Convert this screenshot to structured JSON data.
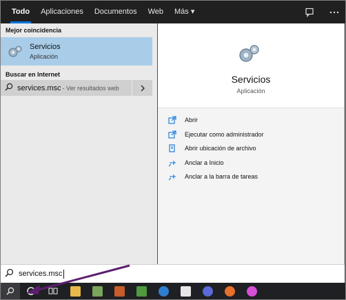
{
  "tabs": [
    "Todo",
    "Aplicaciones",
    "Documentos",
    "Web",
    "Más ▾"
  ],
  "topbar_icons": [
    "feedback-icon",
    "more-icon"
  ],
  "left": {
    "best_match_title": "Mejor coincidencia",
    "best_match": {
      "name": "Servicios",
      "type": "Aplicación",
      "icon": "services-gear-icon"
    },
    "web_title": "Buscar en Internet",
    "web_result": {
      "query": "services.msc",
      "hint": " - Ver resultados web"
    }
  },
  "detail": {
    "title": "Servicios",
    "subtitle": "Aplicación",
    "actions": [
      {
        "label": "Abrir",
        "icon": "open-icon"
      },
      {
        "label": "Ejecutar como administrador",
        "icon": "run-as-admin-icon"
      },
      {
        "label": "Abrir ubicación de archivo",
        "icon": "file-location-icon"
      },
      {
        "label": "Anclar a Inicio",
        "icon": "pin-start-icon"
      },
      {
        "label": "Anclar a la barra de tareas",
        "icon": "pin-taskbar-icon"
      }
    ]
  },
  "search": {
    "value": "services.msc"
  },
  "taskbar": [
    "search-icon",
    "cortana-icon",
    "task-view-icon",
    "file-explorer-icon",
    "app-icon-1",
    "app-icon-2",
    "app-icon-3",
    "app-icon-4",
    "app-icon-5",
    "app-icon-6",
    "firefox-icon",
    "app-icon-7"
  ],
  "colors": {
    "accent": "#0a74d9",
    "selection": "#a9cde9",
    "annotation": "#5b1f6e"
  }
}
